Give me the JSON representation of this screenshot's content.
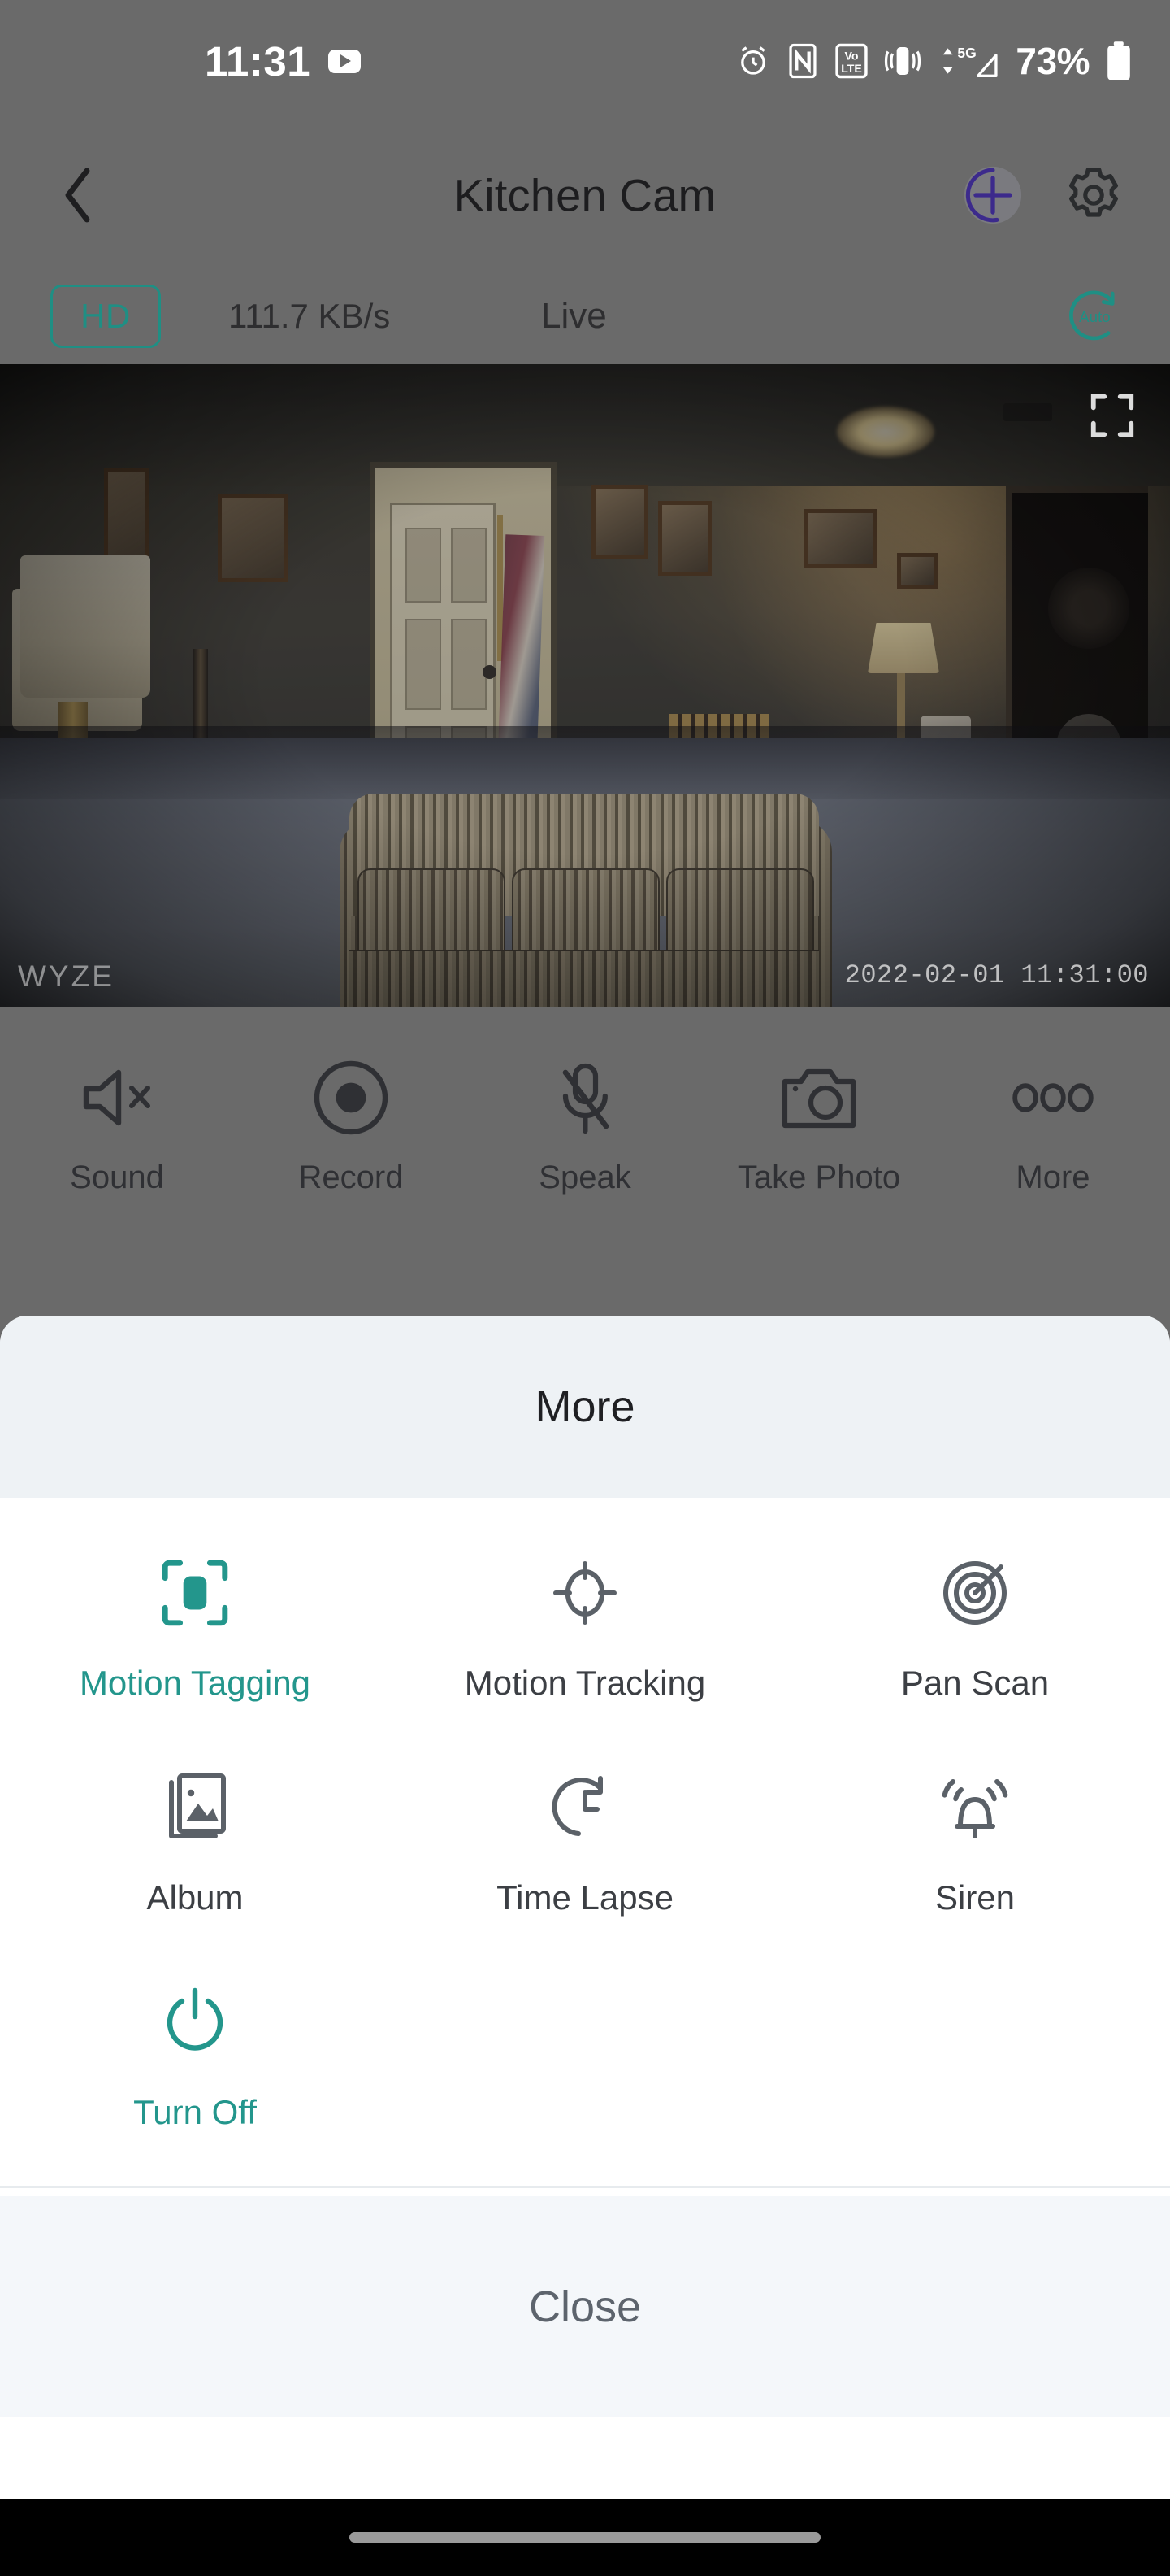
{
  "status_bar": {
    "clock": "11:31",
    "youtube_icon": "youtube-play-icon",
    "icons": [
      "alarm-clock-icon",
      "nfc-icon",
      "volte-icon",
      "vibrate-icon",
      "5g-signal-icon"
    ],
    "signal_label": "5G",
    "battery_percent": "73%",
    "battery_icon": "battery-full-icon"
  },
  "nav_bar": {
    "back_icon": "chevron-left-icon",
    "title": "Kitchen Cam",
    "add_icon": "circle-plus-icon",
    "settings_icon": "gear-icon",
    "add_accent": "#3c2a8c"
  },
  "quality_bar": {
    "hd_label": "HD",
    "bitrate": "111.7 KB/s",
    "live_label": "Live",
    "auto_label": "Auto",
    "auto_icon": "auto-rotate-icon",
    "accent": "#1f8f84"
  },
  "video": {
    "fullscreen_icon": "fullscreen-expand-icon",
    "watermark": "WYZE",
    "timestamp": "2022-02-01  11:31:00",
    "scene_description": "living-room-camera-feed"
  },
  "controls": [
    {
      "icon": "speaker-muted-icon",
      "label": "Sound"
    },
    {
      "icon": "record-circle-icon",
      "label": "Record"
    },
    {
      "icon": "microphone-muted-icon",
      "label": "Speak"
    },
    {
      "icon": "camera-icon",
      "label": "Take Photo"
    },
    {
      "icon": "ellipsis-icon",
      "label": "More"
    }
  ],
  "sheet": {
    "title": "More",
    "active_color": "#23968c",
    "inactive_color": "#5b6168",
    "rows": [
      [
        {
          "icon": "motion-tagging-icon",
          "label": "Motion Tagging",
          "active": true
        },
        {
          "icon": "motion-tracking-icon",
          "label": "Motion Tracking",
          "active": false
        },
        {
          "icon": "pan-scan-icon",
          "label": "Pan Scan",
          "active": false
        }
      ],
      [
        {
          "icon": "album-image-icon",
          "label": "Album",
          "active": false
        },
        {
          "icon": "time-lapse-icon",
          "label": "Time Lapse",
          "active": false
        },
        {
          "icon": "siren-bell-icon",
          "label": "Siren",
          "active": false
        }
      ],
      [
        {
          "icon": "power-icon",
          "label": "Turn Off",
          "active": true
        }
      ]
    ],
    "close_label": "Close"
  },
  "system_nav": {
    "home_indicator": "home-indicator-pill"
  }
}
